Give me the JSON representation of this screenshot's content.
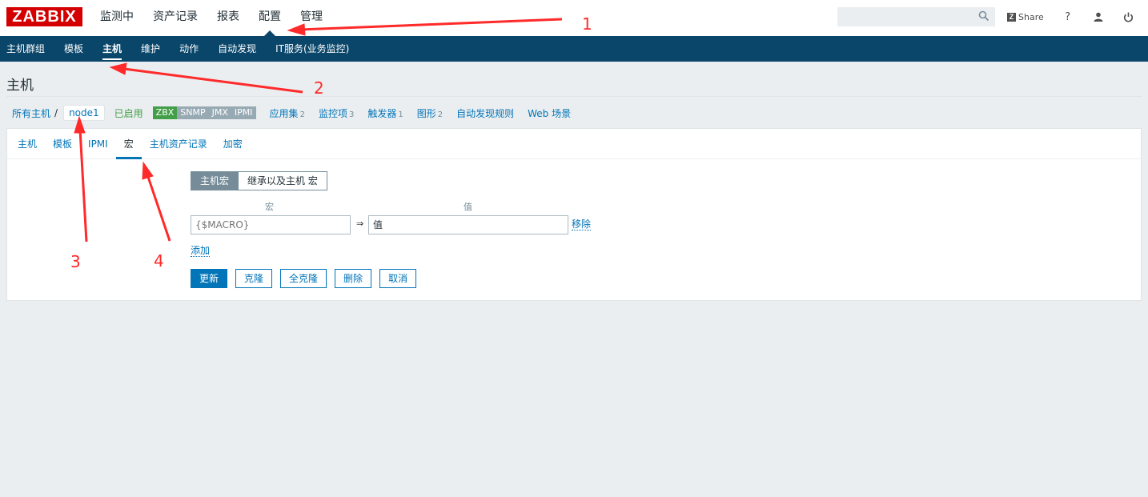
{
  "header": {
    "logo": "ZABBIX",
    "menu": [
      "监测中",
      "资产记录",
      "报表",
      "配置",
      "管理"
    ],
    "selected_menu": "配置",
    "search": {
      "value": "",
      "placeholder": ""
    },
    "share_label": "Share",
    "help_label": "?"
  },
  "subnav": {
    "items": [
      "主机群组",
      "模板",
      "主机",
      "维护",
      "动作",
      "自动发现",
      "IT服务(业务监控)"
    ],
    "selected": "主机"
  },
  "page": {
    "title": "主机"
  },
  "breadcrumb": {
    "all_hosts": "所有主机",
    "separator": "/",
    "current_host": "node1",
    "status": "已启用",
    "availability": [
      {
        "label": "ZBX",
        "state": "available",
        "color": "#429e47"
      },
      {
        "label": "SNMP",
        "state": "unknown",
        "color": "#97aab3"
      },
      {
        "label": "JMX",
        "state": "unknown",
        "color": "#97aab3"
      },
      {
        "label": "IPMI",
        "state": "unknown",
        "color": "#97aab3"
      }
    ],
    "links": [
      {
        "label": "应用集",
        "count": "2"
      },
      {
        "label": "监控项",
        "count": "3"
      },
      {
        "label": "触发器",
        "count": "1"
      },
      {
        "label": "图形",
        "count": "2"
      },
      {
        "label": "自动发现规则",
        "count": ""
      },
      {
        "label": "Web 场景",
        "count": ""
      }
    ]
  },
  "tabs": {
    "items": [
      "主机",
      "模板",
      "IPMI",
      "宏",
      "主机资产记录",
      "加密"
    ],
    "active": "宏"
  },
  "macros": {
    "toggle": {
      "host_label": "主机宏",
      "inherited_label": "继承以及主机 宏",
      "active": "主机宏"
    },
    "col_macro": "宏",
    "col_value": "值",
    "row": {
      "macro_value": "",
      "macro_placeholder": "{$MACRO}",
      "value_value": "",
      "value_placeholder": "值",
      "arrow": "⇒",
      "remove_label": "移除"
    },
    "add_label": "添加"
  },
  "actions": {
    "update": "更新",
    "clone": "克隆",
    "full_clone": "全克隆",
    "delete": "删除",
    "cancel": "取消"
  },
  "annotations": [
    "1",
    "2",
    "3",
    "4"
  ],
  "colors": {
    "logo_red": "#d40000",
    "nav_dark_blue": "#0a466a",
    "link_blue": "#0275b8",
    "enabled_green": "#429e47",
    "annotation_red": "#ff2a2a"
  }
}
